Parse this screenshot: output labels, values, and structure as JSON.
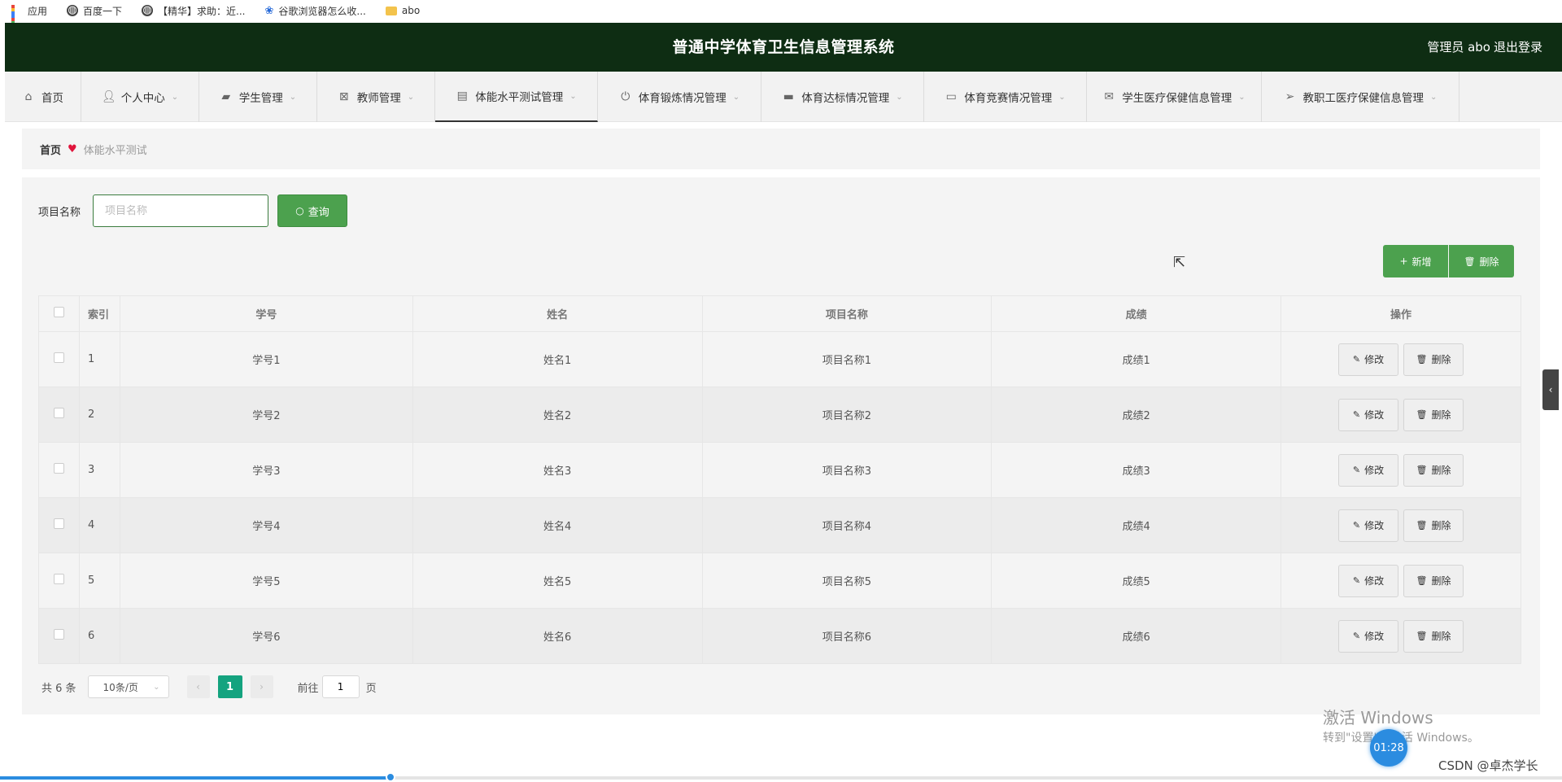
{
  "bookmarks": [
    {
      "label": "应用",
      "icon": "apps-icon"
    },
    {
      "label": "百度一下",
      "icon": "globe-icon"
    },
    {
      "label": "【精华】求助：近...",
      "icon": "globe-icon"
    },
    {
      "label": "谷歌浏览器怎么收...",
      "icon": "paw-icon"
    },
    {
      "label": "abo",
      "icon": "folder-icon"
    }
  ],
  "header": {
    "title": "普通中学体育卫生信息管理系统",
    "user": "管理员 abo",
    "logout": "退出登录",
    "bg_color": "#0e2d13"
  },
  "nav": {
    "items": [
      {
        "label": "首页",
        "icon": "home-icon",
        "has_dropdown": false
      },
      {
        "label": "个人中心",
        "icon": "user-icon",
        "has_dropdown": true
      },
      {
        "label": "学生管理",
        "icon": "briefcase-icon",
        "has_dropdown": true
      },
      {
        "label": "教师管理",
        "icon": "clipboard-x-icon",
        "has_dropdown": true
      },
      {
        "label": "体能水平测试管理",
        "icon": "clipboard-icon",
        "has_dropdown": true,
        "active": true
      },
      {
        "label": "体育锻炼情况管理",
        "icon": "power-icon",
        "has_dropdown": true
      },
      {
        "label": "体育达标情况管理",
        "icon": "chat-icon",
        "has_dropdown": true
      },
      {
        "label": "体育竞赛情况管理",
        "icon": "monitor-icon",
        "has_dropdown": true
      },
      {
        "label": "学生医疗保健信息管理",
        "icon": "mail-icon",
        "has_dropdown": true
      },
      {
        "label": "教职工医疗保健信息管理",
        "icon": "send-icon",
        "has_dropdown": true
      }
    ]
  },
  "breadcrumb": {
    "home": "首页",
    "current": "体能水平测试"
  },
  "search": {
    "label": "项目名称",
    "placeholder": "项目名称",
    "value": "",
    "button": "查询"
  },
  "actions": {
    "add": "新增",
    "delete": "删除",
    "accent_color": "#4ca14e"
  },
  "table": {
    "headers": [
      "索引",
      "学号",
      "姓名",
      "项目名称",
      "成绩",
      "操作"
    ],
    "rows": [
      {
        "index": "1",
        "student_no": "学号1",
        "name": "姓名1",
        "project": "项目名称1",
        "score": "成绩1"
      },
      {
        "index": "2",
        "student_no": "学号2",
        "name": "姓名2",
        "project": "项目名称2",
        "score": "成绩2"
      },
      {
        "index": "3",
        "student_no": "学号3",
        "name": "姓名3",
        "project": "项目名称3",
        "score": "成绩3"
      },
      {
        "index": "4",
        "student_no": "学号4",
        "name": "姓名4",
        "project": "项目名称4",
        "score": "成绩4"
      },
      {
        "index": "5",
        "student_no": "学号5",
        "name": "姓名5",
        "project": "项目名称5",
        "score": "成绩5"
      },
      {
        "index": "6",
        "student_no": "学号6",
        "name": "姓名6",
        "project": "项目名称6",
        "score": "成绩6"
      }
    ],
    "row_edit": "修改",
    "row_delete": "删除"
  },
  "pagination": {
    "total": "共 6 条",
    "page_size": "10条/页",
    "current_page": "1",
    "goto_label": "前往",
    "goto_value": "1",
    "page_suffix": "页",
    "active_color": "#14a37f"
  },
  "overlay": {
    "watermark_title": "激活 Windows",
    "watermark_sub": "转到\"设置\"以激活 Windows。",
    "timer": "01:28",
    "credit": "CSDN @卓杰学长",
    "video_progress": 0.25
  }
}
